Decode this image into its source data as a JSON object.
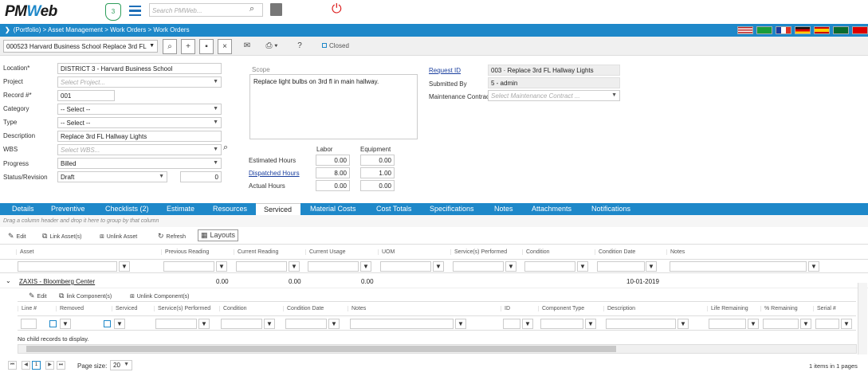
{
  "app": {
    "logo_text": "PMWeb",
    "badge_count": "3",
    "search_placeholder": "Search PMWeb..."
  },
  "breadcrumb": "(Portfolio) > Asset Management > Work Orders > Work Orders",
  "colors": {
    "brand": "#1e88c9",
    "status_ok": "#2e9e5b",
    "power": "#dd2222"
  },
  "toolbar": {
    "record_selector": "000523 Harvard Business School Replace 3rd FL",
    "closed_label": "Closed"
  },
  "form": {
    "location_label": "Location*",
    "location_value": "DISTRICT 3 - Harvard Business School",
    "project_label": "Project",
    "project_placeholder": "Select Project...",
    "record_label": "Record #*",
    "record_value": "001",
    "category_label": "Category",
    "category_value": "-- Select --",
    "type_label": "Type",
    "type_value": "-- Select --",
    "description_label": "Description",
    "description_value": "Replace 3rd FL Hallway Lights",
    "wbs_label": "WBS",
    "wbs_placeholder": "Select WBS...",
    "progress_label": "Progress",
    "progress_value": "Billed",
    "status_label": "Status/Revision",
    "status_value": "Draft",
    "revision_value": "0",
    "scope_label": "Scope",
    "scope_value": "Replace light bulbs on 3rd fl in main hallway.",
    "labor_label": "Labor",
    "equipment_label": "Equipment",
    "est_hours_label": "Estimated Hours",
    "est_labor": "0.00",
    "est_equipment": "0.00",
    "disp_hours_label": "Dispatched Hours",
    "disp_labor": "8.00",
    "disp_equipment": "1.00",
    "actual_hours_label": "Actual Hours",
    "actual_labor": "0.00",
    "actual_equipment": "0.00",
    "request_id_label": "Request ID",
    "request_id_value": "003 · Replace 3rd FL Hallway Lights",
    "submitted_by_label": "Submitted By",
    "submitted_by_value": "5 - admin",
    "maint_contract_label": "Maintenance Contract",
    "maint_contract_placeholder": "Select Maintenance Contract ..."
  },
  "tabs": [
    "Details",
    "Preventive",
    "Checklists (2)",
    "Estimate",
    "Resources",
    "Serviced",
    "Material Costs",
    "Cost Totals",
    "Specifications",
    "Notes",
    "Attachments",
    "Notifications"
  ],
  "active_tab": "Serviced",
  "grid": {
    "group_hint": "Drag a column header and drop it here to group by that column",
    "toolbar": {
      "edit": "Edit",
      "link": "Link Asset(s)",
      "unlink": "Unlink Asset",
      "refresh": "Refresh",
      "layouts": "Layouts"
    },
    "columns": [
      "Asset",
      "Previous Reading",
      "Current Reading",
      "Current Usage",
      "UOM",
      "Service(s) Performed",
      "Condition",
      "Condition Date",
      "Notes"
    ],
    "row": {
      "asset": "ZAXIS - Bloomberg Center",
      "prev": "0.00",
      "curr": "0.00",
      "usage": "0.00",
      "date": "10-01-2019"
    },
    "sub_toolbar": {
      "edit": "Edit",
      "link": "link Component(s)",
      "unlink": "Unlink Component(s)"
    },
    "sub_columns": [
      "Line #",
      "Removed",
      "Serviced",
      "Service(s) Performed",
      "Condition",
      "Condition Date",
      "Notes",
      "ID",
      "Component Type",
      "Description",
      "Life Remaining",
      "% Remaining",
      "Serial #"
    ],
    "sub_empty": "No child records to display."
  },
  "pager": {
    "current_page": "1",
    "page_size_label": "Page size:",
    "page_size": "20",
    "items_info": "1 items in 1 pages"
  }
}
